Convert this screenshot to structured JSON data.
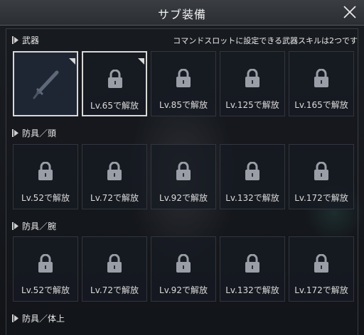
{
  "window": {
    "title": "サブ装備"
  },
  "sections": {
    "weapon": {
      "label": "武器",
      "note": "コマンドスロットに設定できる武器スキルは2つです"
    },
    "head": {
      "label": "防具／頭"
    },
    "arm": {
      "label": "防具／腕"
    },
    "body": {
      "label": "防具／体上"
    }
  },
  "weapon_slots": [
    "",
    "Lv.65で解放",
    "Lv.85で解放",
    "Lv.125で解放",
    "Lv.165で解放"
  ],
  "head_slots": [
    "Lv.52で解放",
    "Lv.72で解放",
    "Lv.92で解放",
    "Lv.132で解放",
    "Lv.172で解放"
  ],
  "arm_slots": [
    "Lv.52で解放",
    "Lv.72で解放",
    "Lv.92で解放",
    "Lv.132で解放",
    "Lv.172で解放"
  ],
  "icons": {
    "close": "close-icon",
    "lock": "lock-icon",
    "sword": "sword-icon",
    "section_marker": "section-marker-icon"
  },
  "colors": {
    "frame": "#d8d8d8",
    "slot_bg": "#161a22",
    "title_bg": "#2b2e33"
  }
}
